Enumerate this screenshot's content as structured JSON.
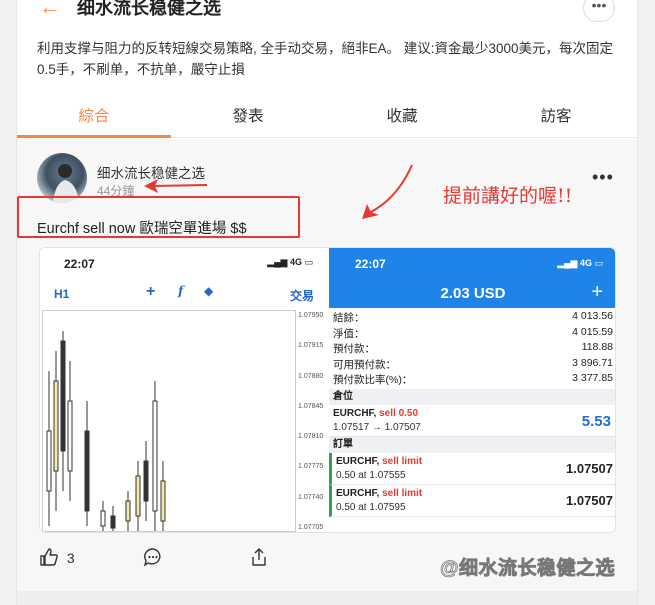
{
  "header": {
    "back_icon": "arrow-left-icon",
    "title": "细水流长稳健之选",
    "more_label": "•••"
  },
  "description": "利用支撑与阻力的反转短線交易策略, 全手动交易，絕非EA。 建议:資金最少3000美元，每次固定0.5手，不刷单，不抗单，嚴守止損",
  "tabs": [
    {
      "label": "綜合",
      "active": true
    },
    {
      "label": "發表",
      "active": false
    },
    {
      "label": "收藏",
      "active": false
    },
    {
      "label": "訪客",
      "active": false
    }
  ],
  "post": {
    "author": "细水流长稳健之选",
    "time": "44分鐘",
    "more_label": "•••",
    "text": "Eurchf sell now 歐瑞空單進場 $$",
    "annotation": "提前講好的喔!!",
    "actions": {
      "like_count": "3"
    },
    "watermark": "@细水流长稳健之选"
  },
  "screenshot": {
    "left": {
      "clock": "22:07",
      "network": "4G",
      "timeframe": "H1",
      "trade_label": "交易",
      "price_ticks": [
        "1.07950",
        "1.07915",
        "1.07880",
        "1.07845",
        "1.07810",
        "1.07775",
        "1.07740",
        "1.07705"
      ]
    },
    "right": {
      "clock": "22:07",
      "network": "4G",
      "balance_header": "2.03 USD",
      "account_rows": [
        {
          "label": "結餘：",
          "value": "4 013.56"
        },
        {
          "label": "淨值：",
          "value": "4 015.59"
        },
        {
          "label": "預付款：",
          "value": "118.88"
        },
        {
          "label": "可用預付款：",
          "value": "3 896.71"
        },
        {
          "label": "預付款比率(%)：",
          "value": "3 377.85"
        }
      ],
      "positions_title": "倉位",
      "position": {
        "symbol": "EURCHF,",
        "side": "sell 0.50",
        "detail": "1.07517 → 1.07507",
        "profit": "5.53"
      },
      "orders_title": "訂單",
      "orders": [
        {
          "symbol": "EURCHF,",
          "side": "sell limit",
          "detail": "0.50 at 1.07555",
          "price": "1.07507"
        },
        {
          "symbol": "EURCHF,",
          "side": "sell limit",
          "detail": "0.50 at 1.07595",
          "price": "1.07507"
        }
      ]
    }
  },
  "colors": {
    "accent": "#f08a4b",
    "annotation_red": "#e53935",
    "mt_blue": "#1f84e8"
  }
}
